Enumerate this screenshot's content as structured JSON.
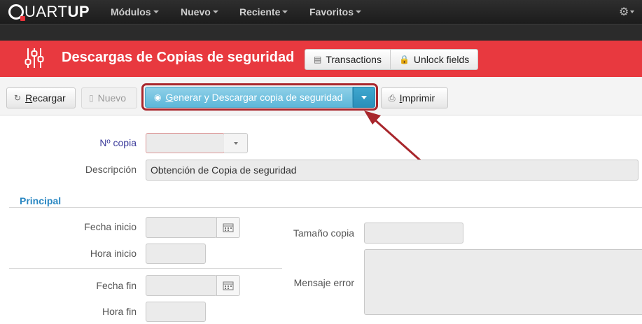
{
  "app": {
    "logo_main": "UART",
    "logo_bold": "UP"
  },
  "topnav": {
    "items": [
      "Módulos",
      "Nuevo",
      "Reciente",
      "Favoritos"
    ]
  },
  "header": {
    "title": "Descargas de Copias de seguridad",
    "transactions_label": "Transactions",
    "unlock_label": "Unlock fields",
    "accent_color": "#e8393f"
  },
  "toolbar": {
    "reload_prefix": "",
    "reload_underlined": "R",
    "reload_rest": "ecargar",
    "new_label": "Nuevo",
    "generate_underlined": "G",
    "generate_rest": "enerar y Descargar copia de seguridad",
    "print_underlined": "I",
    "print_rest": "mprimir"
  },
  "form": {
    "copy_number_label": "Nº copia",
    "copy_number_value": "",
    "description_label": "Descripción",
    "description_value": "Obtención de Copia de seguridad",
    "section_title": "Principal",
    "start_date_label": "Fecha inicio",
    "start_time_label": "Hora inicio",
    "end_date_label": "Fecha fin",
    "end_time_label": "Hora fin",
    "size_label": "Tamaño copia",
    "error_label": "Mensaje error"
  }
}
